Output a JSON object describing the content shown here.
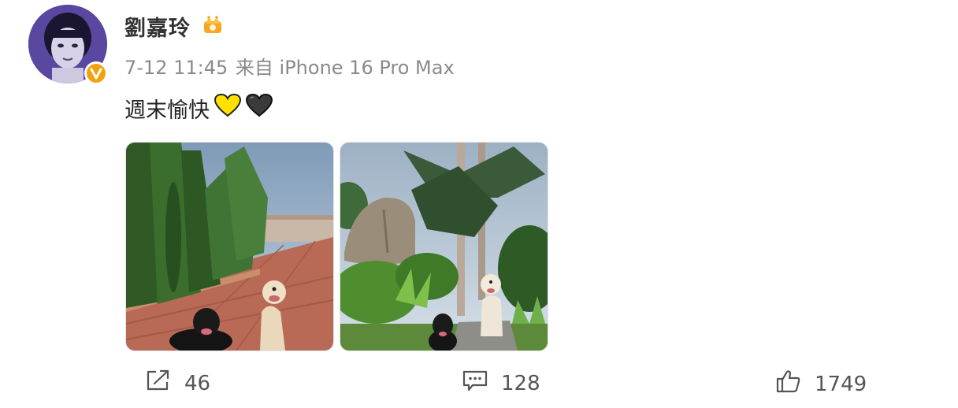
{
  "post": {
    "username": "劉嘉玲",
    "timestamp": "7-12 11:45",
    "source": "来自 iPhone 16 Pro Max",
    "text": "週末愉快",
    "emoji": [
      "yellow-heart",
      "black-heart"
    ]
  },
  "badges": {
    "verified_color": "#f2a20c",
    "crown_color": "#f6a623"
  },
  "photos": [
    {
      "name": "dogs-on-brick-path"
    },
    {
      "name": "dogs-in-garden"
    }
  ],
  "actions": {
    "repost_count": "46",
    "comment_count": "128",
    "like_count": "1749"
  },
  "icons": [
    "share-icon",
    "comment-icon",
    "thumbs-up-icon",
    "verified-badge-icon",
    "crown-icon"
  ]
}
